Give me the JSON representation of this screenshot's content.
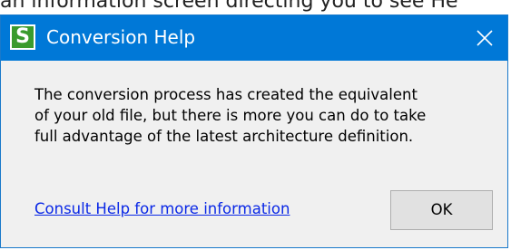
{
  "background_caption": "an information screen directing you to see He",
  "dialog": {
    "title": "Conversion Help",
    "app_icon_glyph": "S",
    "app_icon_color": "#3a9b2e",
    "titlebar_color": "#0078d7",
    "close_icon": "close-icon",
    "message_lines": [
      "The conversion process has created the equivalent",
      "of your old file, but there is more you can do to take",
      "full advantage of the latest architecture definition."
    ],
    "help_link_label": "Consult Help for more information",
    "ok_label": "OK"
  }
}
